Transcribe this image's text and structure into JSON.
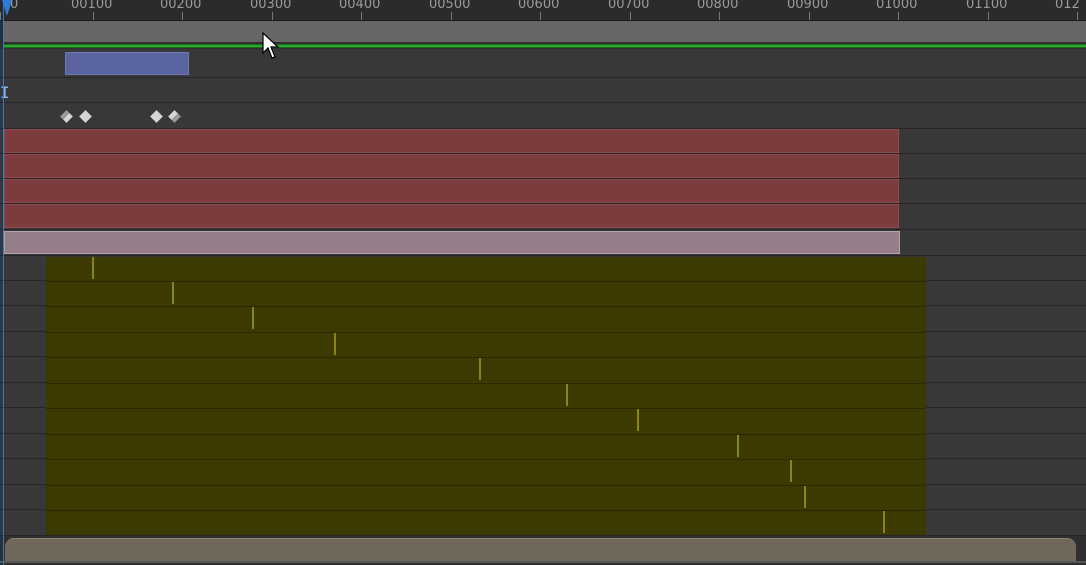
{
  "ruler": {
    "labels": [
      "0",
      "00100",
      "00200",
      "00300",
      "00400",
      "00500",
      "00600",
      "00700",
      "00800",
      "00900",
      "01000",
      "01100",
      "012"
    ]
  },
  "tracks": {
    "icon_rows": {
      "i_marker": "I"
    }
  },
  "colors": {
    "work_area": "#676767",
    "green_line": "#27a92c",
    "blue_clip": "#5a64a0",
    "red_layer": "#7c3c3d",
    "pink_layer": "#957e89",
    "olive_layer": "#3c3a00",
    "olive_marker": "#8c8416",
    "playhead": "#2f7bd8",
    "scroll_thumb": "#6f6759"
  },
  "icons": {
    "keyframe": "diamond-icon",
    "cursor": "mouse-pointer-icon",
    "playhead": "playhead-icon"
  }
}
